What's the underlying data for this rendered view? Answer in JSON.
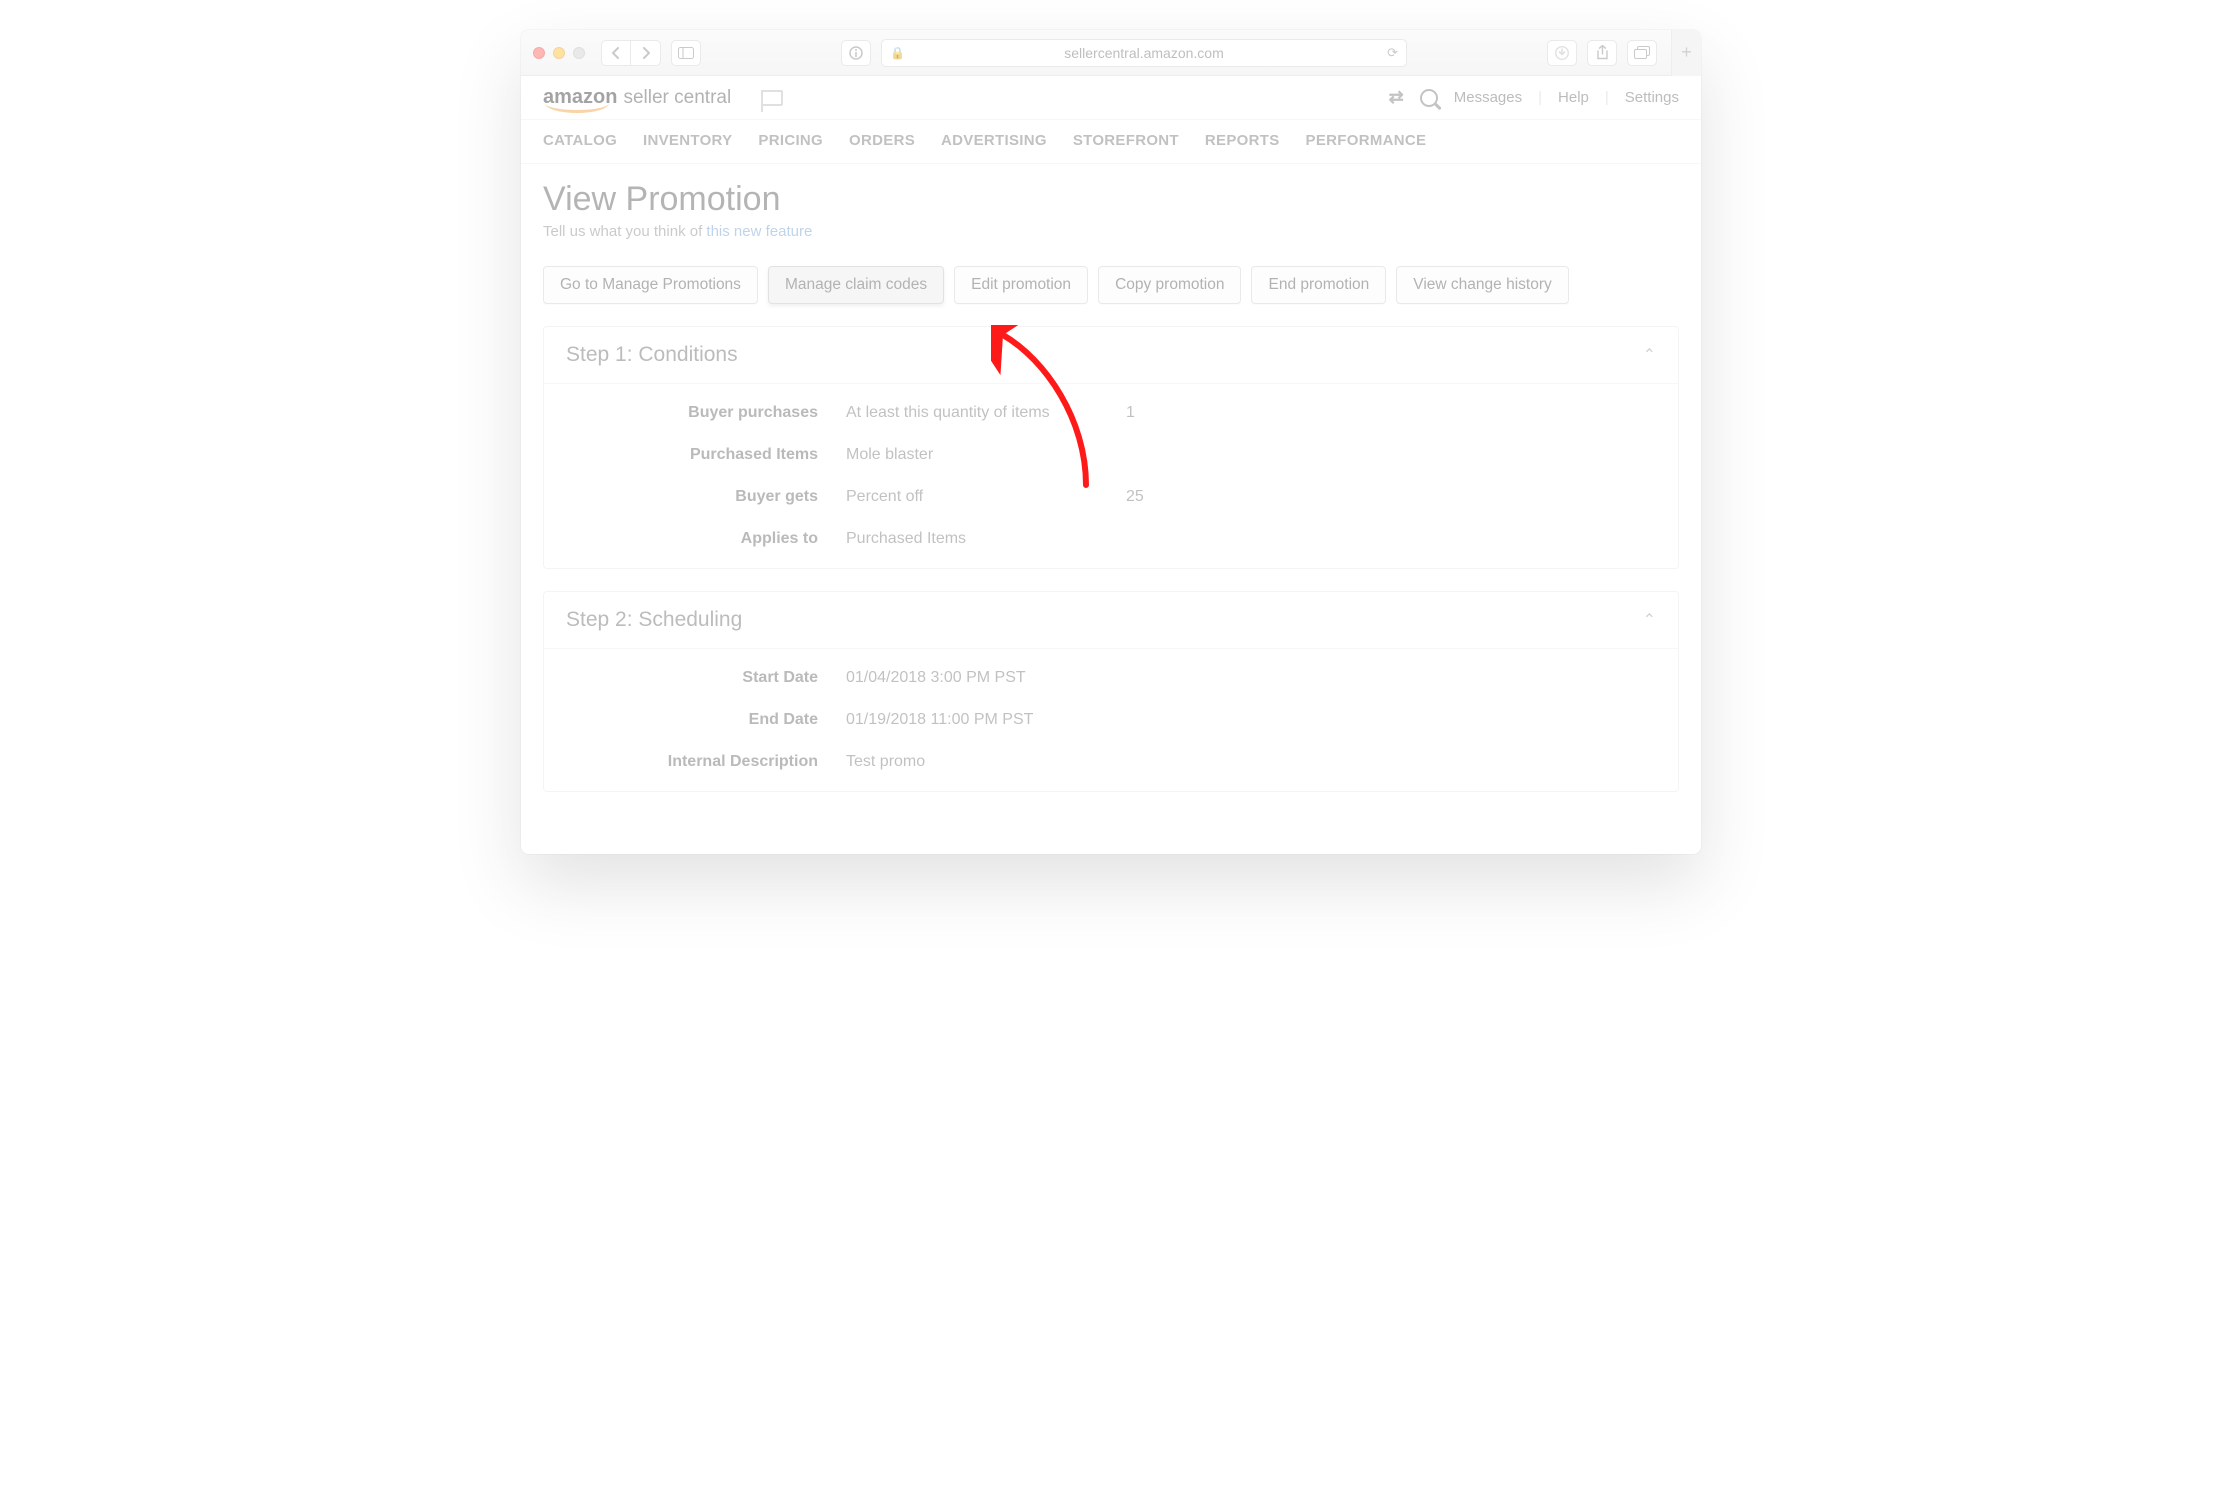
{
  "browser": {
    "url_display": "sellercentral.amazon.com"
  },
  "brand": {
    "amazon": "amazon",
    "seller_central": "seller central"
  },
  "header_links": {
    "messages": "Messages",
    "help": "Help",
    "settings": "Settings"
  },
  "nav": [
    "CATALOG",
    "INVENTORY",
    "PRICING",
    "ORDERS",
    "ADVERTISING",
    "STOREFRONT",
    "REPORTS",
    "PERFORMANCE"
  ],
  "page_title": "View Promotion",
  "feedback": {
    "lead": "Tell us what you think of ",
    "link": "this new feature"
  },
  "actions": {
    "manage_promotions": "Go to Manage Promotions",
    "manage_claim_codes": "Manage claim codes",
    "edit_promotion": "Edit promotion",
    "copy_promotion": "Copy promotion",
    "end_promotion": "End promotion",
    "view_history": "View change history"
  },
  "step1": {
    "title": "Step 1: Conditions",
    "rows": {
      "buyer_purchases": {
        "label": "Buyer purchases",
        "desc": "At least this quantity of items",
        "value": "1"
      },
      "purchased_items": {
        "label": "Purchased Items",
        "desc": "Mole blaster"
      },
      "buyer_gets": {
        "label": "Buyer gets",
        "desc": "Percent off",
        "value": "25"
      },
      "applies_to": {
        "label": "Applies to",
        "desc": "Purchased Items"
      }
    }
  },
  "step2": {
    "title": "Step 2: Scheduling",
    "rows": {
      "start": {
        "label": "Start Date",
        "value": "01/04/2018   3:00 PM   PST"
      },
      "end": {
        "label": "End Date",
        "value": "01/19/2018   11:00 PM   PST"
      },
      "desc": {
        "label": "Internal Description",
        "value": "Test promo"
      }
    }
  }
}
